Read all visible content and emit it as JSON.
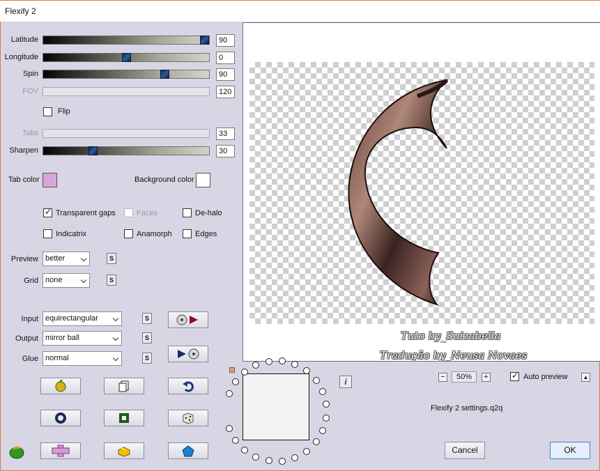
{
  "window": {
    "title": "Flexify 2"
  },
  "sliders": [
    {
      "label": "Latitude",
      "value": "90",
      "level": 0.97,
      "enabled": true
    },
    {
      "label": "Longitude",
      "value": "0",
      "level": 0.5,
      "enabled": true
    },
    {
      "label": "Spin",
      "value": "90",
      "level": 0.73,
      "enabled": true
    },
    {
      "label": "FOV",
      "value": "120",
      "level": null,
      "enabled": false
    },
    {
      "label": "Tabs",
      "value": "33",
      "level": null,
      "enabled": false
    },
    {
      "label": "Sharpen",
      "value": "30",
      "level": 0.3,
      "enabled": true
    }
  ],
  "flip": {
    "label": "Flip",
    "checked": false
  },
  "colors": {
    "tab_label": "Tab color",
    "tab_value": "#d7a6d9",
    "background_label": "Background color",
    "background_value": "#ffffff"
  },
  "options": {
    "transparent_gaps": {
      "label": "Transparent gaps",
      "checked": true
    },
    "faces": {
      "label": "Faces",
      "checked": false,
      "enabled": false
    },
    "de_halo": {
      "label": "De-halo",
      "checked": false
    },
    "indicatrix": {
      "label": "Indicatrix",
      "checked": false
    },
    "anamorph": {
      "label": "Anamorph",
      "checked": false
    },
    "edges": {
      "label": "Edges",
      "checked": false
    }
  },
  "preview_select": {
    "label": "Preview",
    "value": "better"
  },
  "grid_select": {
    "label": "Grid",
    "value": "none"
  },
  "input_select": {
    "label": "Input",
    "value": "equirectangular"
  },
  "output_select": {
    "label": "Output",
    "value": "mirror ball"
  },
  "glue_select": {
    "label": "Glue",
    "value": "normal"
  },
  "s_button_label": "S",
  "info_label": "i",
  "zoom": {
    "value": "50%",
    "minus": "−",
    "plus": "+"
  },
  "auto_preview": {
    "label": "Auto preview",
    "checked": true
  },
  "settings_file": "Flexify 2 settings.q2q",
  "watermark": {
    "line1": "Tuto by_Suizabella",
    "line2": "Tradução by_Neusa Novaes"
  },
  "buttons": {
    "cancel": "Cancel",
    "ok": "OK"
  },
  "accent_color": "#e8773a"
}
